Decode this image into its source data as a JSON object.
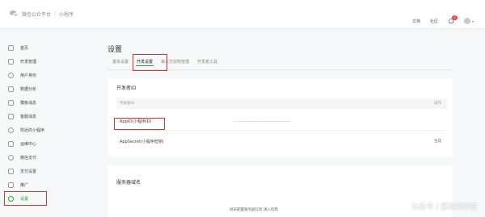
{
  "header": {
    "platform": "微信公众平台",
    "separator": "|",
    "product": "小程序",
    "links": [
      "文档",
      "社区"
    ],
    "notification_count": "2",
    "avatar_caret": "▾"
  },
  "sidebar": {
    "items": [
      {
        "label": "首页",
        "icon": "home-icon"
      },
      {
        "label": "开发管理",
        "icon": "code-icon"
      },
      {
        "label": "用户身份",
        "icon": "user-icon"
      },
      {
        "label": "数据分析",
        "icon": "chart-icon"
      },
      {
        "label": "模板消息",
        "icon": "template-icon"
      },
      {
        "label": "客服消息",
        "icon": "message-icon"
      },
      {
        "label": "附近的小程序",
        "icon": "location-icon"
      },
      {
        "label": "运维中心",
        "icon": "wrench-icon"
      },
      {
        "label": "微信支付",
        "icon": "pay-icon"
      },
      {
        "label": "支付设置",
        "icon": "payment-settings-icon"
      },
      {
        "label": "推广",
        "icon": "promote-icon"
      },
      {
        "label": "设置",
        "icon": "gear-icon",
        "active": true
      }
    ]
  },
  "main": {
    "title": "设置",
    "tabs": [
      "基本设置",
      "开发设置",
      "第三方授权管理",
      "开发者工具"
    ],
    "active_tab": "开发设置",
    "developer_card": {
      "title": "开发者ID",
      "columns": [
        "开发者ID",
        "操作"
      ],
      "rows": [
        {
          "label": "AppID(小程序ID)",
          "value": "~~~~~~~~~~~~~~~~~~~~",
          "action": ""
        },
        {
          "label": "AppSecret(小程序密钥)",
          "value": "",
          "action": "生成"
        }
      ]
    },
    "server_card": {
      "title": "服务器域名",
      "note": "尚未配置服务器信息",
      "link": "填入指南"
    }
  },
  "watermark": "头条号 / 嘉滋实验室",
  "colors": {
    "accent_green": "#1aad19",
    "highlight_red": "#d9322b",
    "link_blue": "#576b95"
  }
}
